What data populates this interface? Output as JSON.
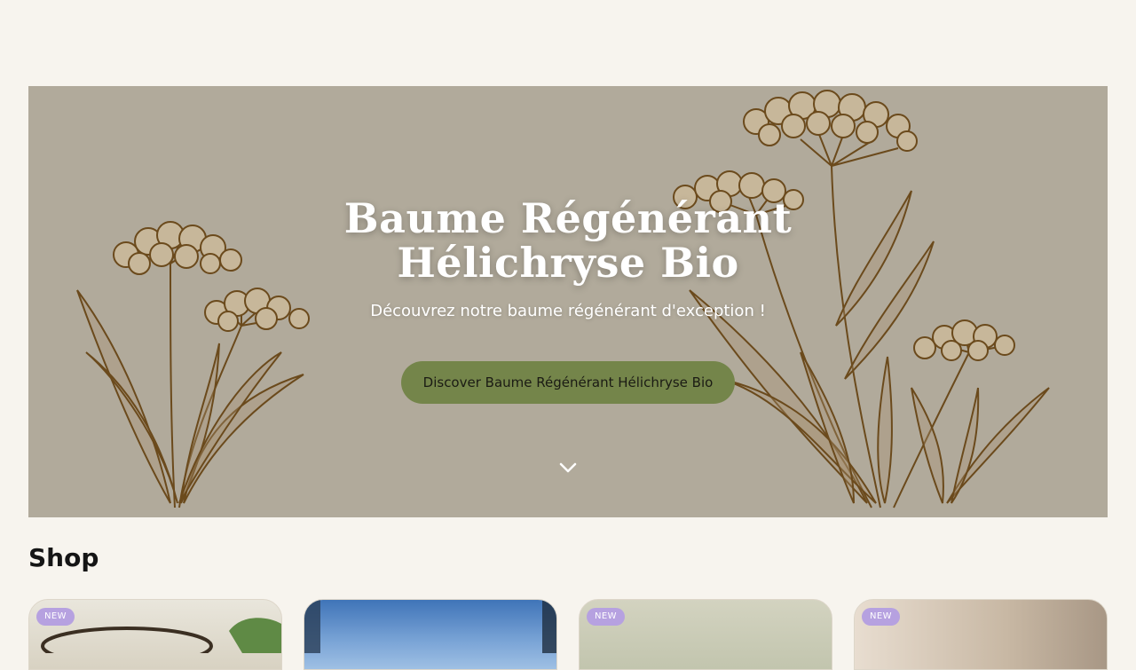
{
  "hero": {
    "title": "Baume Régénérant Hélichryse Bio",
    "subtitle": "Découvrez notre baume régénérant d'exception !",
    "cta_label": "Discover Baume Régénérant Hélichryse Bio",
    "scroll_icon": "chevron-down-icon",
    "background_color": "#b1aa9b",
    "button_color": "#74854a"
  },
  "shop": {
    "title": "Shop",
    "products": [
      {
        "badge": "NEW",
        "image": "balm-jar-with-leaves"
      },
      {
        "badge": "",
        "image": "blue-sky-photo"
      },
      {
        "badge": "NEW",
        "image": "green-soft-photo"
      },
      {
        "badge": "NEW",
        "image": "beige-soft-photo"
      }
    ]
  },
  "colors": {
    "page_background": "#f7f4ee",
    "badge": "#b6a1e0"
  }
}
